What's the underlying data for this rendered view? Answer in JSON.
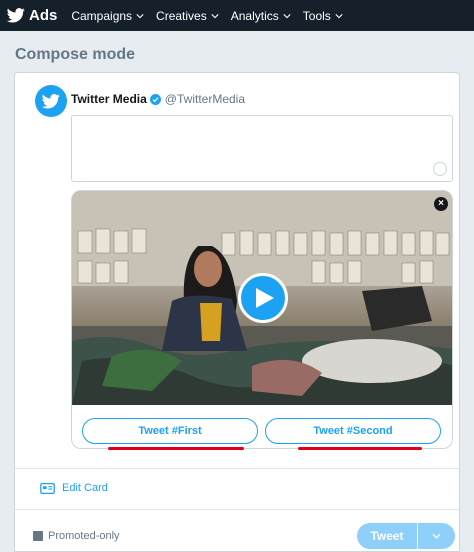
{
  "topbar": {
    "brand": "Ads",
    "nav": [
      {
        "label": "Campaigns"
      },
      {
        "label": "Creatives"
      },
      {
        "label": "Analytics"
      },
      {
        "label": "Tools"
      }
    ]
  },
  "page": {
    "title": "Compose mode"
  },
  "composer": {
    "account_name": "Twitter Media",
    "account_handle": "@TwitterMedia",
    "tweet_text": ""
  },
  "card": {
    "close_label": "×",
    "buttons": [
      {
        "label": "Tweet #First"
      },
      {
        "label": "Tweet #Second"
      }
    ],
    "edit_label": "Edit Card"
  },
  "footer": {
    "promoted_label": "Promoted-only",
    "tweet_label": "Tweet"
  },
  "colors": {
    "accent": "#1da1f2",
    "topbar": "#15202b",
    "annotation": "#e0001b"
  }
}
